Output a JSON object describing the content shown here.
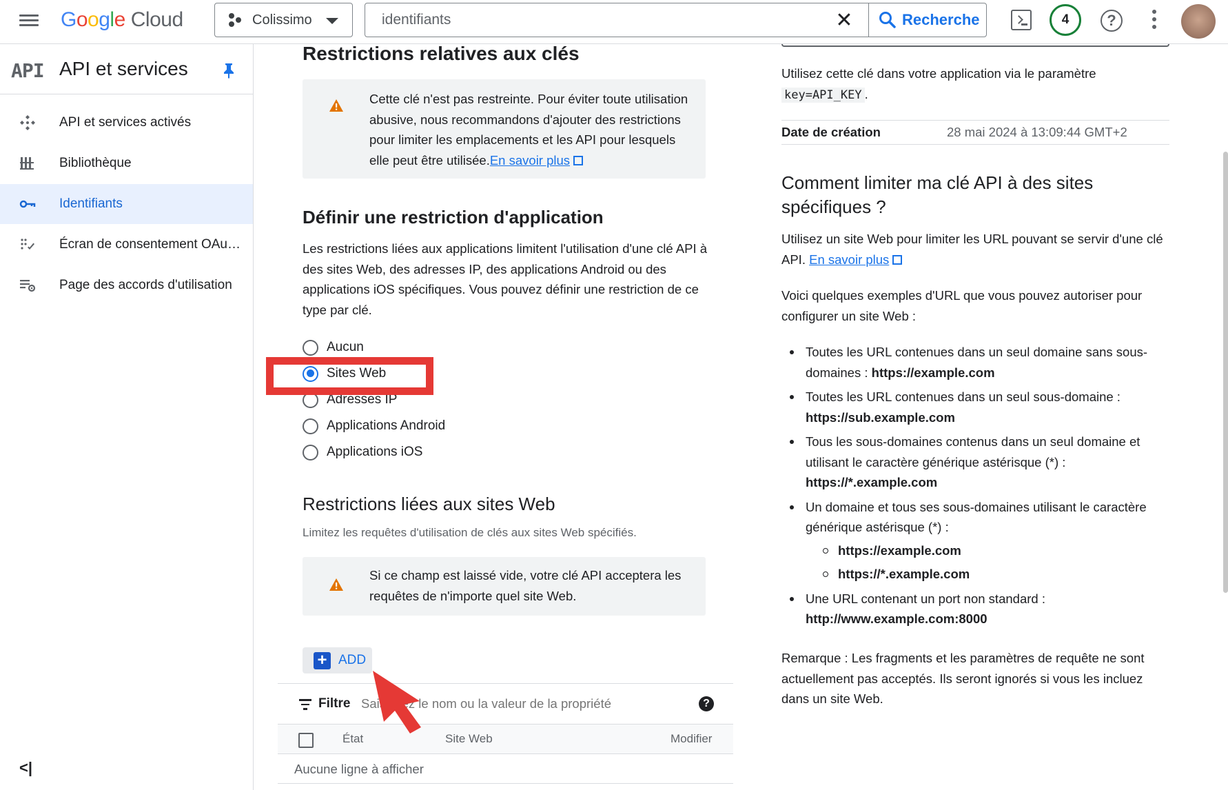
{
  "topbar": {
    "logo_letters": [
      "G",
      "o",
      "o",
      "g",
      "l",
      "e"
    ],
    "logo_cloud": "Cloud",
    "project": "Colissimo",
    "search_value": "identifiants",
    "search_button": "Recherche",
    "notifications": "4",
    "help_glyph": "?",
    "clear_glyph": "✕",
    "icons": [
      "menu-icon",
      "project-icon",
      "chevron-down-icon",
      "close-icon",
      "search-icon",
      "terminal-icon",
      "help-icon",
      "more-vert-icon"
    ]
  },
  "sidebar": {
    "logo_text": "API",
    "title": "API et services",
    "items": [
      {
        "label": "API et services activés",
        "icon": "api-icon"
      },
      {
        "label": "Bibliothèque",
        "icon": "library-icon"
      },
      {
        "label": "Identifiants",
        "icon": "key-icon",
        "active": true
      },
      {
        "label": "Écran de consentement OAu…",
        "icon": "consent-icon"
      },
      {
        "label": "Page des accords d'utilisation",
        "icon": "agreements-icon"
      }
    ],
    "collapse_glyph": "<|"
  },
  "main": {
    "key_restrictions_title": "Restrictions relatives aux clés",
    "warning1_text": "Cette clé n'est pas restreinte. Pour éviter toute utilisation abusive, nous recommandons d'ajouter des restrictions pour limiter les emplacements et les API pour lesquels elle peut être utilisée.",
    "warning1_link": "En savoir plus",
    "app_restriction_title": "Définir une restriction d'application",
    "app_restriction_desc": "Les restrictions liées aux applications limitent l'utilisation d'une clé API à des sites Web, des adresses IP, des applications Android ou des applications iOS spécifiques. Vous pouvez définir une restriction de ce type par clé.",
    "radio_options": [
      "Aucun",
      "Sites Web",
      "Adresses IP",
      "Applications Android",
      "Applications iOS"
    ],
    "radio_selected": "Sites Web",
    "website_restrictions_title": "Restrictions liées aux sites Web",
    "website_restrictions_hint": "Limitez les requêtes d'utilisation de clés aux sites Web spécifiés.",
    "warning2_text": "Si ce champ est laissé vide, votre clé API acceptera les requêtes de n'importe quel site Web.",
    "add_label": "ADD",
    "filter_label": "Filtre",
    "filter_placeholder": "Saisissez le nom ou la valeur de la propriété",
    "filter_help_glyph": "?",
    "table_headers": [
      "État",
      "Site Web",
      "Modifier"
    ],
    "empty_text": "Aucune ligne à afficher"
  },
  "right": {
    "usage_text": "Utilisez cette clé dans votre application via le paramètre",
    "usage_code": "key=API_KEY",
    "usage_end": ".",
    "created_label": "Date de création",
    "created_value": "28 mai 2024 à 13:09:44 GMT+2",
    "how_title": "Comment limiter ma clé API à des sites spécifiques ?",
    "how_text": "Utilisez un site Web pour limiter les URL pouvant se servir d'une clé API.",
    "how_link": "En savoir plus",
    "examples_intro": "Voici quelques exemples d'URL que vous pouvez autoriser pour configurer un site Web :",
    "examples": [
      {
        "text": "Toutes les URL contenues dans un seul domaine sans sous-domaines : ",
        "url": "https://example.com"
      },
      {
        "text": "Toutes les URL contenues dans un seul sous-domaine : ",
        "url": "https://sub.example.com"
      },
      {
        "text": "Tous les sous-domaines contenus dans un seul domaine et utilisant le caractère générique astérisque (*) : ",
        "url": "https://*.example.com"
      },
      {
        "text": "Un domaine et tous ses sous-domaines utilisant le caractère générique astérisque (*) :",
        "url": ""
      },
      {
        "text": "Une URL contenant un port non standard : ",
        "url": "http://www.example.com:8000"
      }
    ],
    "sub_examples": [
      "https://example.com",
      "https://*.example.com"
    ],
    "note": "Remarque : Les fragments et les paramètres de requête ne sont actuellement pas acceptés. Ils seront ignorés si vous les incluez dans un site Web."
  },
  "colors": {
    "accent": "#1a73e8",
    "active_bg": "#e8f0fe",
    "warning": "#e37400",
    "highlight": "#e53935",
    "notification_ring": "#188038"
  }
}
